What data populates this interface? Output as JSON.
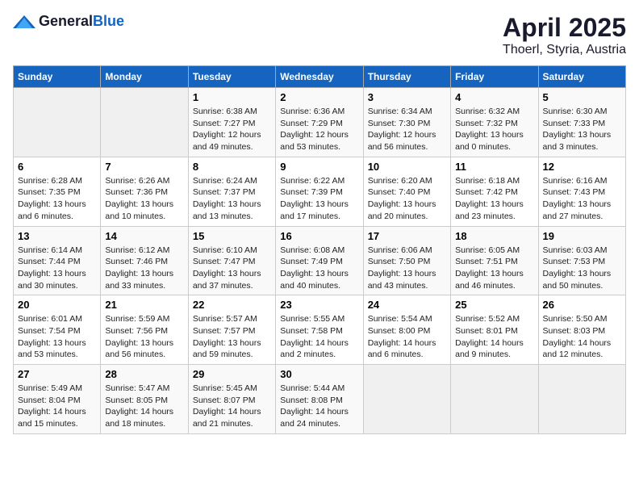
{
  "header": {
    "logo_general": "General",
    "logo_blue": "Blue",
    "month": "April 2025",
    "location": "Thoerl, Styria, Austria"
  },
  "weekdays": [
    "Sunday",
    "Monday",
    "Tuesday",
    "Wednesday",
    "Thursday",
    "Friday",
    "Saturday"
  ],
  "weeks": [
    [
      {
        "day": "",
        "info": ""
      },
      {
        "day": "",
        "info": ""
      },
      {
        "day": "1",
        "info": "Sunrise: 6:38 AM\nSunset: 7:27 PM\nDaylight: 12 hours and 49 minutes."
      },
      {
        "day": "2",
        "info": "Sunrise: 6:36 AM\nSunset: 7:29 PM\nDaylight: 12 hours and 53 minutes."
      },
      {
        "day": "3",
        "info": "Sunrise: 6:34 AM\nSunset: 7:30 PM\nDaylight: 12 hours and 56 minutes."
      },
      {
        "day": "4",
        "info": "Sunrise: 6:32 AM\nSunset: 7:32 PM\nDaylight: 13 hours and 0 minutes."
      },
      {
        "day": "5",
        "info": "Sunrise: 6:30 AM\nSunset: 7:33 PM\nDaylight: 13 hours and 3 minutes."
      }
    ],
    [
      {
        "day": "6",
        "info": "Sunrise: 6:28 AM\nSunset: 7:35 PM\nDaylight: 13 hours and 6 minutes."
      },
      {
        "day": "7",
        "info": "Sunrise: 6:26 AM\nSunset: 7:36 PM\nDaylight: 13 hours and 10 minutes."
      },
      {
        "day": "8",
        "info": "Sunrise: 6:24 AM\nSunset: 7:37 PM\nDaylight: 13 hours and 13 minutes."
      },
      {
        "day": "9",
        "info": "Sunrise: 6:22 AM\nSunset: 7:39 PM\nDaylight: 13 hours and 17 minutes."
      },
      {
        "day": "10",
        "info": "Sunrise: 6:20 AM\nSunset: 7:40 PM\nDaylight: 13 hours and 20 minutes."
      },
      {
        "day": "11",
        "info": "Sunrise: 6:18 AM\nSunset: 7:42 PM\nDaylight: 13 hours and 23 minutes."
      },
      {
        "day": "12",
        "info": "Sunrise: 6:16 AM\nSunset: 7:43 PM\nDaylight: 13 hours and 27 minutes."
      }
    ],
    [
      {
        "day": "13",
        "info": "Sunrise: 6:14 AM\nSunset: 7:44 PM\nDaylight: 13 hours and 30 minutes."
      },
      {
        "day": "14",
        "info": "Sunrise: 6:12 AM\nSunset: 7:46 PM\nDaylight: 13 hours and 33 minutes."
      },
      {
        "day": "15",
        "info": "Sunrise: 6:10 AM\nSunset: 7:47 PM\nDaylight: 13 hours and 37 minutes."
      },
      {
        "day": "16",
        "info": "Sunrise: 6:08 AM\nSunset: 7:49 PM\nDaylight: 13 hours and 40 minutes."
      },
      {
        "day": "17",
        "info": "Sunrise: 6:06 AM\nSunset: 7:50 PM\nDaylight: 13 hours and 43 minutes."
      },
      {
        "day": "18",
        "info": "Sunrise: 6:05 AM\nSunset: 7:51 PM\nDaylight: 13 hours and 46 minutes."
      },
      {
        "day": "19",
        "info": "Sunrise: 6:03 AM\nSunset: 7:53 PM\nDaylight: 13 hours and 50 minutes."
      }
    ],
    [
      {
        "day": "20",
        "info": "Sunrise: 6:01 AM\nSunset: 7:54 PM\nDaylight: 13 hours and 53 minutes."
      },
      {
        "day": "21",
        "info": "Sunrise: 5:59 AM\nSunset: 7:56 PM\nDaylight: 13 hours and 56 minutes."
      },
      {
        "day": "22",
        "info": "Sunrise: 5:57 AM\nSunset: 7:57 PM\nDaylight: 13 hours and 59 minutes."
      },
      {
        "day": "23",
        "info": "Sunrise: 5:55 AM\nSunset: 7:58 PM\nDaylight: 14 hours and 2 minutes."
      },
      {
        "day": "24",
        "info": "Sunrise: 5:54 AM\nSunset: 8:00 PM\nDaylight: 14 hours and 6 minutes."
      },
      {
        "day": "25",
        "info": "Sunrise: 5:52 AM\nSunset: 8:01 PM\nDaylight: 14 hours and 9 minutes."
      },
      {
        "day": "26",
        "info": "Sunrise: 5:50 AM\nSunset: 8:03 PM\nDaylight: 14 hours and 12 minutes."
      }
    ],
    [
      {
        "day": "27",
        "info": "Sunrise: 5:49 AM\nSunset: 8:04 PM\nDaylight: 14 hours and 15 minutes."
      },
      {
        "day": "28",
        "info": "Sunrise: 5:47 AM\nSunset: 8:05 PM\nDaylight: 14 hours and 18 minutes."
      },
      {
        "day": "29",
        "info": "Sunrise: 5:45 AM\nSunset: 8:07 PM\nDaylight: 14 hours and 21 minutes."
      },
      {
        "day": "30",
        "info": "Sunrise: 5:44 AM\nSunset: 8:08 PM\nDaylight: 14 hours and 24 minutes."
      },
      {
        "day": "",
        "info": ""
      },
      {
        "day": "",
        "info": ""
      },
      {
        "day": "",
        "info": ""
      }
    ]
  ]
}
